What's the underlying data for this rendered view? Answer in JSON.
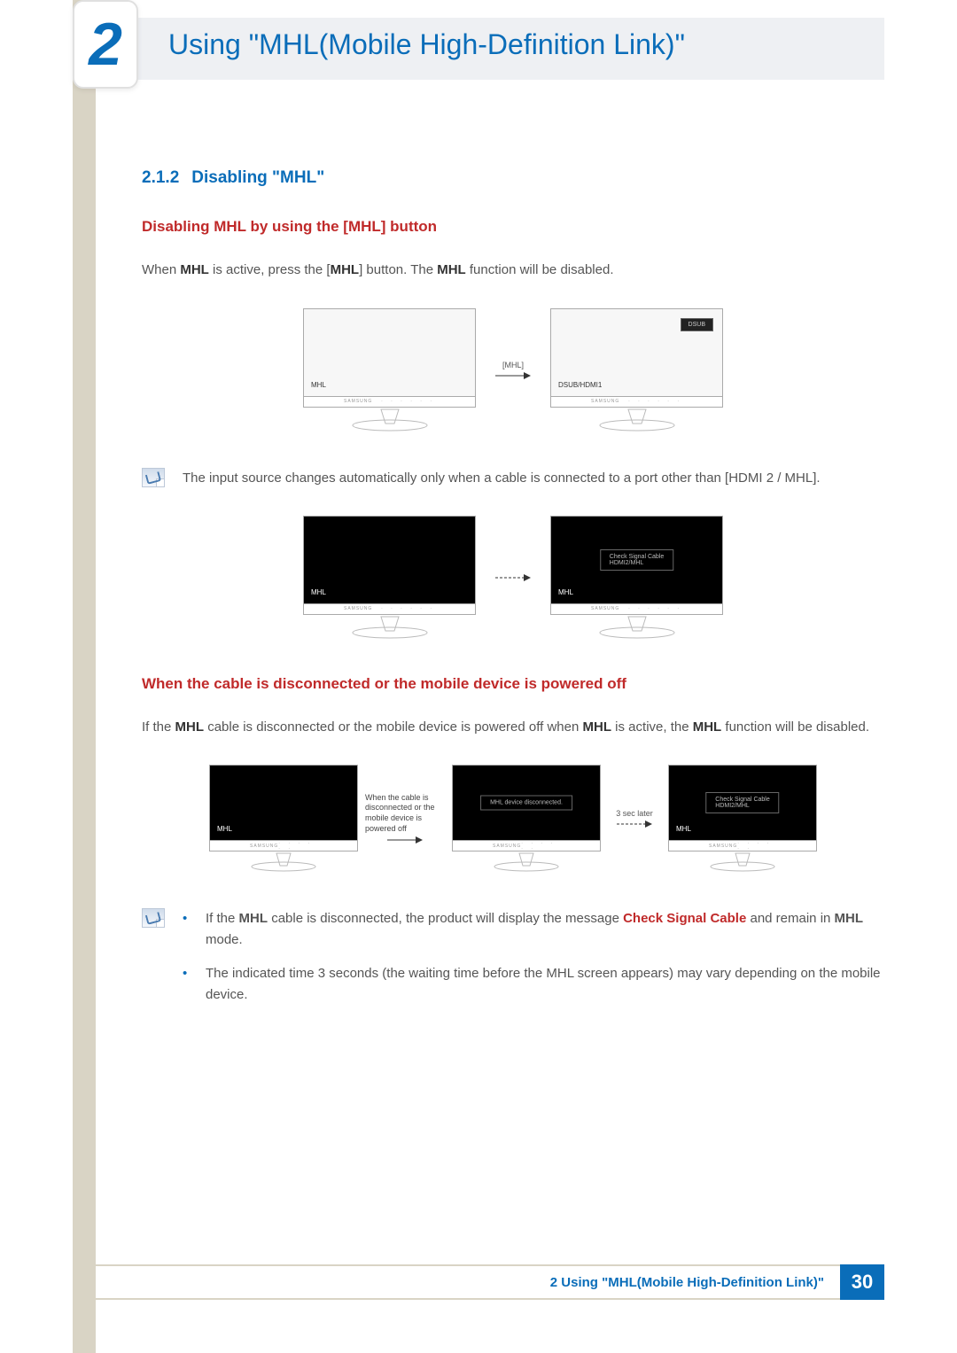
{
  "header": {
    "chapter_number": "2",
    "title": "Using \"MHL(Mobile High-Definition Link)\""
  },
  "sections": {
    "s1": {
      "num": "2.1.2",
      "title": "Disabling \"MHL\""
    },
    "sub1": {
      "title": "Disabling MHL by using the [MHL] button"
    },
    "p1_a": "When ",
    "p1_b": "MHL",
    "p1_c": " is active, press the [",
    "p1_d": "MHL",
    "p1_e": "] button. The ",
    "p1_f": "MHL",
    "p1_g": " function will be disabled.",
    "fig1": {
      "arrow_label": "[MHL]",
      "screen_a_label": "MHL",
      "screen_b_label": "DSUB/HDMI1",
      "osd_top": "DSUB",
      "brand": "SAMSUNG",
      "dots": "· · · · · ·"
    },
    "note1": "The input source changes automatically only when a cable is connected to a port other than [HDMI 2 / MHL].",
    "fig2": {
      "screen_a_label": "MHL",
      "screen_b_label": "MHL",
      "osd_line1": "Check Signal Cable",
      "osd_line2": "HDMI2/MHL"
    },
    "sub2": {
      "title": "When the cable is disconnected or the mobile device is powered off"
    },
    "p2_a": "If the ",
    "p2_b": "MHL",
    "p2_c": " cable is disconnected or the mobile device is powered off when ",
    "p2_d": "MHL",
    "p2_e": " is active, the ",
    "p2_f": "MHL",
    "p2_g": " function will be disabled.",
    "fig3": {
      "screen_a_label": "MHL",
      "center_msg": "MHL device disconnected.",
      "screen_c_label": "MHL",
      "osd_line1": "Check Signal Cable",
      "osd_line2": "HDMI2/MHL",
      "arrow1_note": "When the cable is disconnected or the mobile device is powered off",
      "arrow2_label": "3 sec later"
    },
    "note2": {
      "li1_a": "If the ",
      "li1_b": "MHL",
      "li1_c": " cable is disconnected, the product will display the message ",
      "li1_d": "Check Signal Cable",
      "li1_e": " and remain in ",
      "li1_f": "MHL",
      "li1_g": " mode.",
      "li2": "The indicated time 3 seconds (the waiting time before the MHL screen appears) may vary depending on the mobile device."
    }
  },
  "footer": {
    "text": "2 Using \"MHL(Mobile High-Definition Link)\"",
    "page": "30"
  }
}
